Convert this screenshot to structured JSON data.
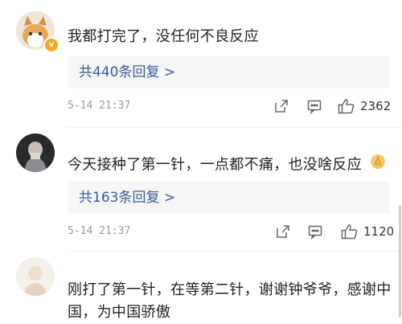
{
  "comments": [
    {
      "text": "我都打完了，没任何不良反应",
      "reply_label": "共440条回复 >",
      "time": "5-14 21:37",
      "likes": "2362"
    },
    {
      "text": "今天接种了第一针，一点都不痛，也没啥反应",
      "reply_label": "共163条回复 >",
      "time": "5-14 21:37",
      "likes": "1120"
    },
    {
      "text": "刚打了第一针，在等第二针，谢谢钟爷爷，感谢中国，为中国骄傲"
    }
  ],
  "icons": {
    "share": "share-icon",
    "comment": "comment-icon",
    "like": "thumbs-up-icon",
    "badge": "verified-badge-icon",
    "emoji": "pray-emoji-icon"
  },
  "colors": {
    "reply_link": "#3b5b9a",
    "meta_text": "#999999",
    "reply_bg": "#f6f6f6"
  }
}
